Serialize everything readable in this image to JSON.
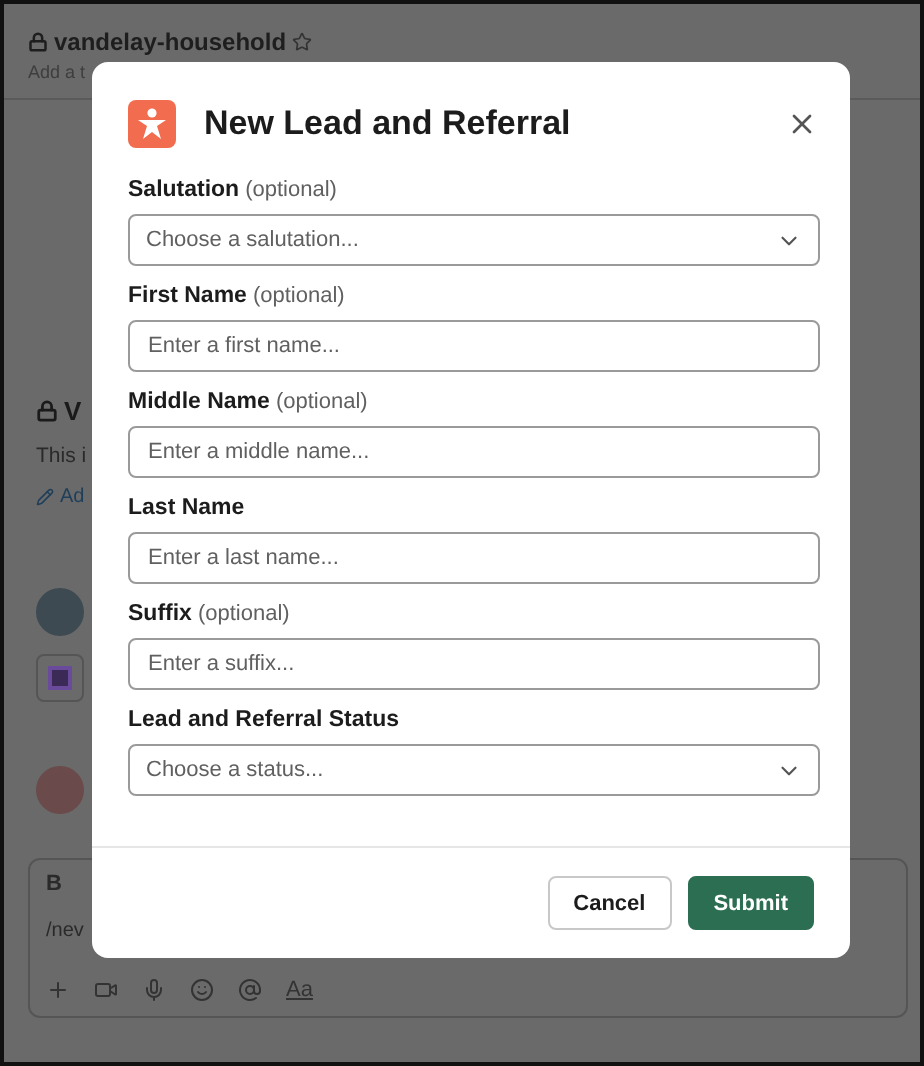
{
  "channel": {
    "name": "vandelay-household",
    "topic": "Add a t"
  },
  "channel_intro": {
    "title": "V",
    "text": "This i",
    "add_link": "Ad"
  },
  "composer": {
    "format_button": "B",
    "text": "/nev",
    "text_style_button": "Aa"
  },
  "modal": {
    "title": "New Lead and Referral",
    "fields": [
      {
        "label": "Salutation",
        "optional": "(optional)",
        "kind": "select",
        "placeholder": "Choose a salutation..."
      },
      {
        "label": "First Name",
        "optional": "(optional)",
        "kind": "text",
        "placeholder": "Enter a first name..."
      },
      {
        "label": "Middle Name",
        "optional": "(optional)",
        "kind": "text",
        "placeholder": "Enter a middle name..."
      },
      {
        "label": "Last Name",
        "kind": "text",
        "placeholder": "Enter a last name..."
      },
      {
        "label": "Suffix",
        "optional": "(optional)",
        "kind": "text",
        "placeholder": "Enter a suffix..."
      },
      {
        "label": "Lead and Referral Status",
        "kind": "select",
        "placeholder": "Choose a status..."
      }
    ],
    "buttons": [
      {
        "label": "Cancel",
        "kind": "secondary"
      },
      {
        "label": "Submit",
        "kind": "primary"
      }
    ]
  }
}
